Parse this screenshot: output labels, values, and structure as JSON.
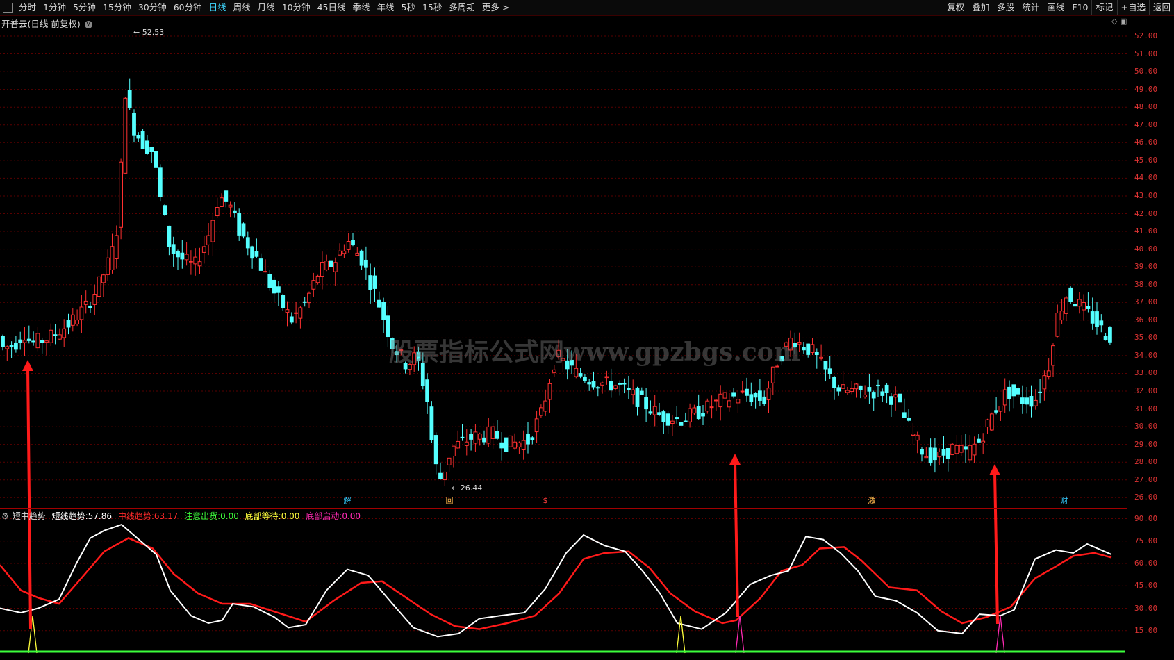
{
  "toolbar": {
    "periods": [
      "分时",
      "1分钟",
      "5分钟",
      "15分钟",
      "30分钟",
      "60分钟",
      "日线",
      "周线",
      "月线",
      "10分钟",
      "45日线",
      "季线",
      "年线",
      "5秒",
      "15秒",
      "多周期",
      "更多 >"
    ],
    "active_period": "日线",
    "right_buttons": [
      "复权",
      "叠加",
      "多股",
      "统计",
      "画线",
      "F10",
      "标记",
      "+自选",
      "返回"
    ]
  },
  "chart_title": "开普云(日线 前复权)",
  "price_axis": [
    "52.00",
    "51.00",
    "50.00",
    "49.00",
    "48.00",
    "47.00",
    "46.00",
    "45.00",
    "44.00",
    "43.00",
    "42.00",
    "41.00",
    "40.00",
    "39.00",
    "38.00",
    "37.00",
    "36.00",
    "35.00",
    "34.00",
    "33.00",
    "32.00",
    "31.00",
    "30.00",
    "29.00",
    "28.00",
    "27.00",
    "26.00"
  ],
  "indicator_axis": [
    "90.00",
    "75.00",
    "60.00",
    "45.00",
    "30.00",
    "15.00"
  ],
  "high_label": "52.53",
  "low_label": "26.44",
  "event_markers": [
    "解",
    "回",
    "$",
    "激",
    "财"
  ],
  "watermark": "股票指标公式网www.gpzbgs.com",
  "indicator": {
    "name": "短中趋势",
    "short_label": "短线趋势:",
    "short_value": "57.86",
    "mid_label": "中线趋势:",
    "mid_value": "63.17",
    "ship_label": "注意出货:",
    "ship_value": "0.00",
    "wait_label": "底部等待:",
    "wait_value": "0.00",
    "start_label": "底部启动:",
    "start_value": "0.00"
  },
  "colors": {
    "up": "#ff3030",
    "down": "#54ffff",
    "short_line": "#ffffff",
    "mid_line": "#ff1a1a",
    "grid": "#5a0000"
  }
}
